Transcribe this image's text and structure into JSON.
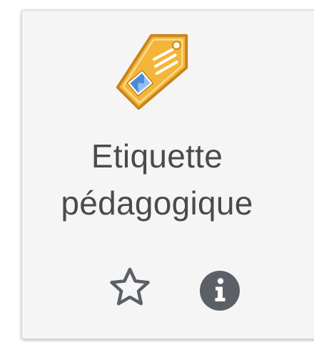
{
  "module": {
    "icon": "label-tag-icon",
    "title_line1": "Etiquette",
    "title_line2": "pédagogique"
  },
  "actions": {
    "star_icon": "star-outline-icon",
    "info_icon": "info-circle-icon"
  },
  "colors": {
    "card_background": "#f5f5f5",
    "title_text": "#4a4a4a",
    "icon_gray": "#5b6066",
    "tag_orange": "#f0a92e",
    "tag_blue": "#4a8bd6"
  }
}
